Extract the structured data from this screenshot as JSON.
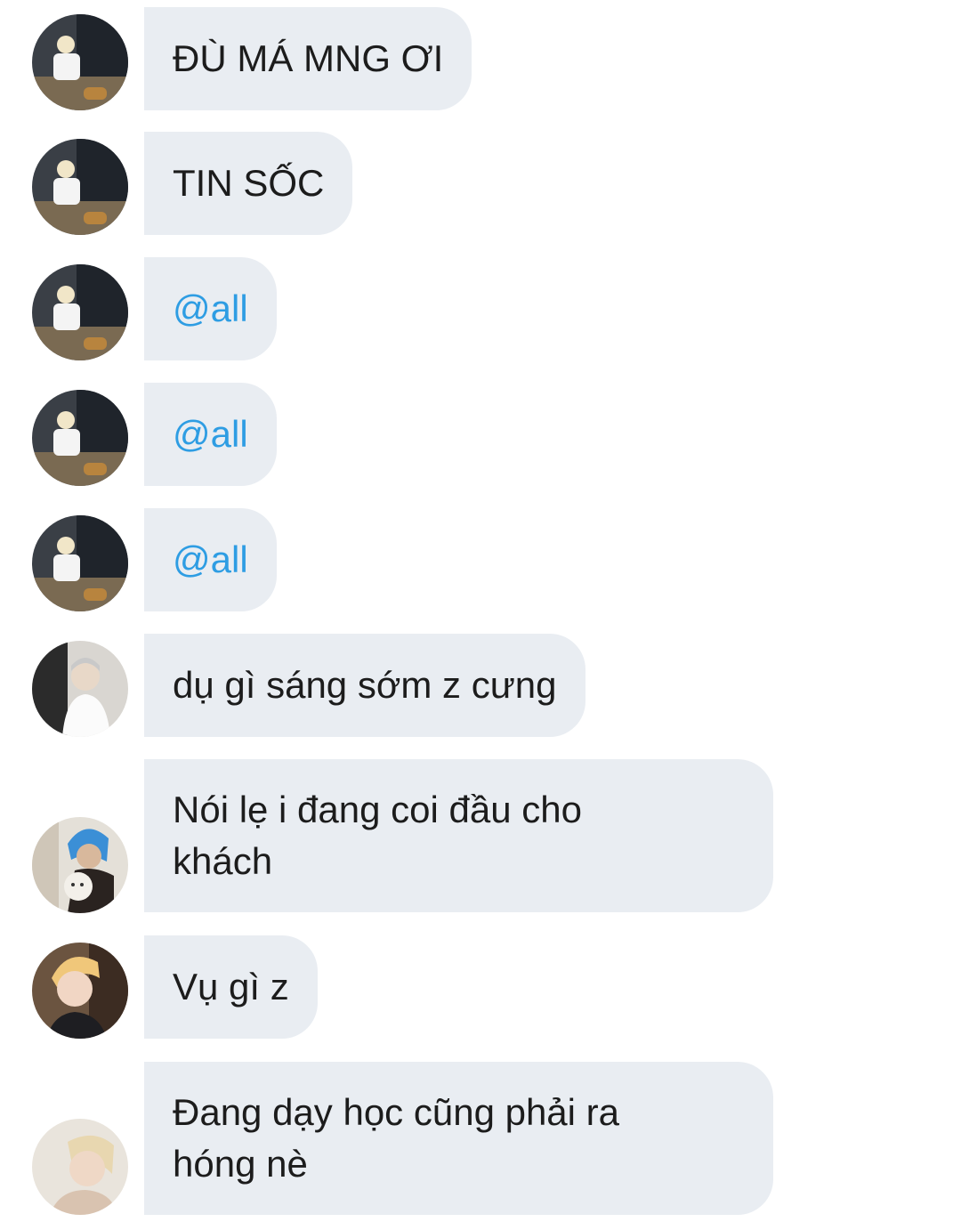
{
  "messages": [
    {
      "avatar": "sender-a-avatar",
      "text": "ĐÙ MÁ MNG ƠI",
      "mention": false
    },
    {
      "avatar": "sender-a-avatar",
      "text": "TIN SỐC",
      "mention": false
    },
    {
      "avatar": "sender-a-avatar",
      "text": "@all",
      "mention": true
    },
    {
      "avatar": "sender-a-avatar",
      "text": "@all",
      "mention": true
    },
    {
      "avatar": "sender-a-avatar",
      "text": "@all",
      "mention": true
    },
    {
      "avatar": "sender-b-avatar",
      "text": "dụ gì sáng sớm z cưng",
      "mention": false
    },
    {
      "avatar": "sender-c-avatar",
      "text_lines": [
        "Nói lẹ i đang coi đầu cho",
        "khách"
      ],
      "mention": false
    },
    {
      "avatar": "sender-d-avatar",
      "text": "Vụ gì z",
      "mention": false
    },
    {
      "avatar": "sender-e-avatar",
      "text_lines": [
        "Đang dạy học cũng phải ra",
        "hóng nè"
      ],
      "mention": false
    }
  ],
  "colors": {
    "bubble_bg": "#e9edf2",
    "text": "#1c1c1c",
    "mention": "#2e9de3",
    "background": "#ffffff"
  }
}
